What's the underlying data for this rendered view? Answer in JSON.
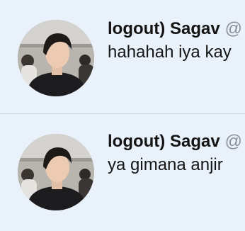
{
  "tweets": [
    {
      "display_name": "logout) Sagav",
      "handle": "@",
      "text": "hahahah iya kay"
    },
    {
      "display_name": "logout) Sagav",
      "handle": "@",
      "text": "ya gimana anjir"
    }
  ],
  "colors": {
    "background": "#e9f1fa",
    "divider": "#c8d2dc",
    "handle": "#8a8f95",
    "text": "#161616"
  }
}
